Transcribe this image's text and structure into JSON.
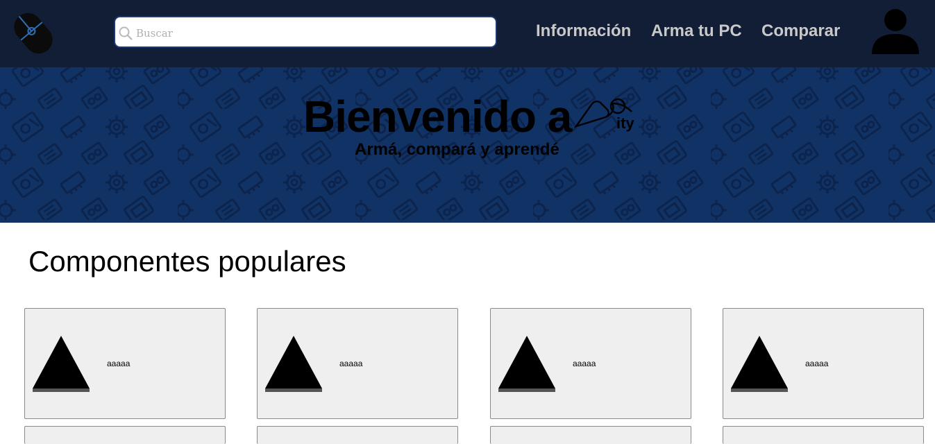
{
  "header": {
    "logo_icon": "mouse-logo-icon",
    "search": {
      "placeholder": "Buscar",
      "value": ""
    },
    "nav": [
      "Información",
      "Arma tu PC",
      "Comparar"
    ],
    "user_icon": "user-avatar-icon",
    "colors": {
      "bar": "#121d36",
      "nav_text": "#c9c9c9",
      "search_border": "#1b3a73"
    }
  },
  "hero": {
    "title": "Bienvenido a",
    "brand": "ity",
    "subtitle": "Armá, compará y aprendé",
    "background": "#113264"
  },
  "main": {
    "section_title": "Componentes populares",
    "cards": [
      {
        "label": "aaaaa",
        "icon": "triangle-image-icon"
      },
      {
        "label": "aaaaa",
        "icon": "triangle-image-icon"
      },
      {
        "label": "aaaaa",
        "icon": "triangle-image-icon"
      },
      {
        "label": "aaaaa",
        "icon": "triangle-image-icon"
      },
      {
        "label": "",
        "icon": ""
      },
      {
        "label": "",
        "icon": ""
      },
      {
        "label": "",
        "icon": ""
      },
      {
        "label": "",
        "icon": ""
      }
    ]
  }
}
